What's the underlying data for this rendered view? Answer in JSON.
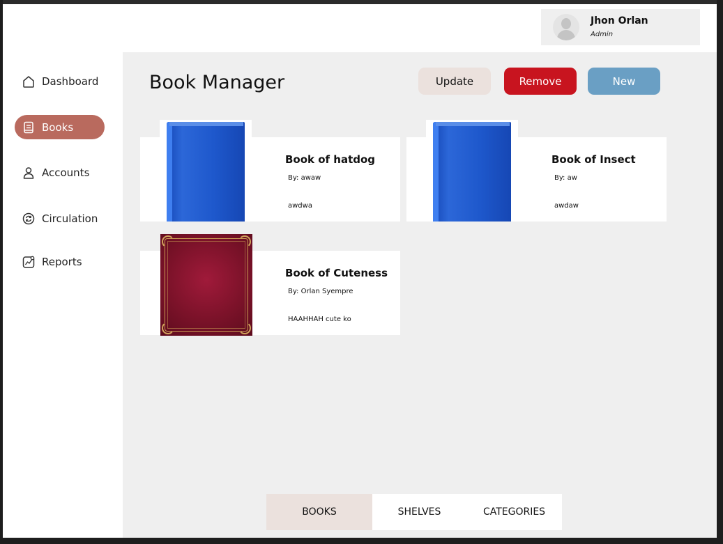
{
  "user": {
    "name": "Jhon Orlan",
    "role": "Admin"
  },
  "sidebar": {
    "items": [
      {
        "label": "Dashboard",
        "icon": "home-icon",
        "active": false
      },
      {
        "label": "Books",
        "icon": "book-icon",
        "active": true
      },
      {
        "label": "Accounts",
        "icon": "user-icon",
        "active": false
      },
      {
        "label": "Circulation",
        "icon": "circulation-icon",
        "active": false
      },
      {
        "label": "Reports",
        "icon": "reports-icon",
        "active": false
      }
    ]
  },
  "main": {
    "title": "Book Manager",
    "actions": {
      "update": "Update",
      "remove": "Remove",
      "new": "New"
    },
    "books": [
      {
        "title": "Book of hatdog",
        "author": "By: awaw",
        "description": "awdwa",
        "cover": "blue-book"
      },
      {
        "title": "Book of Insect",
        "author": "By: aw",
        "description": "awdaw",
        "cover": "blue-book"
      },
      {
        "title": "Book of Cuteness",
        "author": "By: Orlan Syempre",
        "description": "HAAHHAH cute ko",
        "cover": "ornate-red"
      }
    ],
    "tabs": [
      {
        "label": "BOOKS",
        "active": true
      },
      {
        "label": "SHELVES",
        "active": false
      },
      {
        "label": "CATEGORIES",
        "active": false
      }
    ]
  },
  "colors": {
    "accent": "#b96a5e",
    "remove": "#c8141f",
    "new": "#6a9fc4",
    "update": "#ebe1dd",
    "main_bg": "#efefef"
  }
}
